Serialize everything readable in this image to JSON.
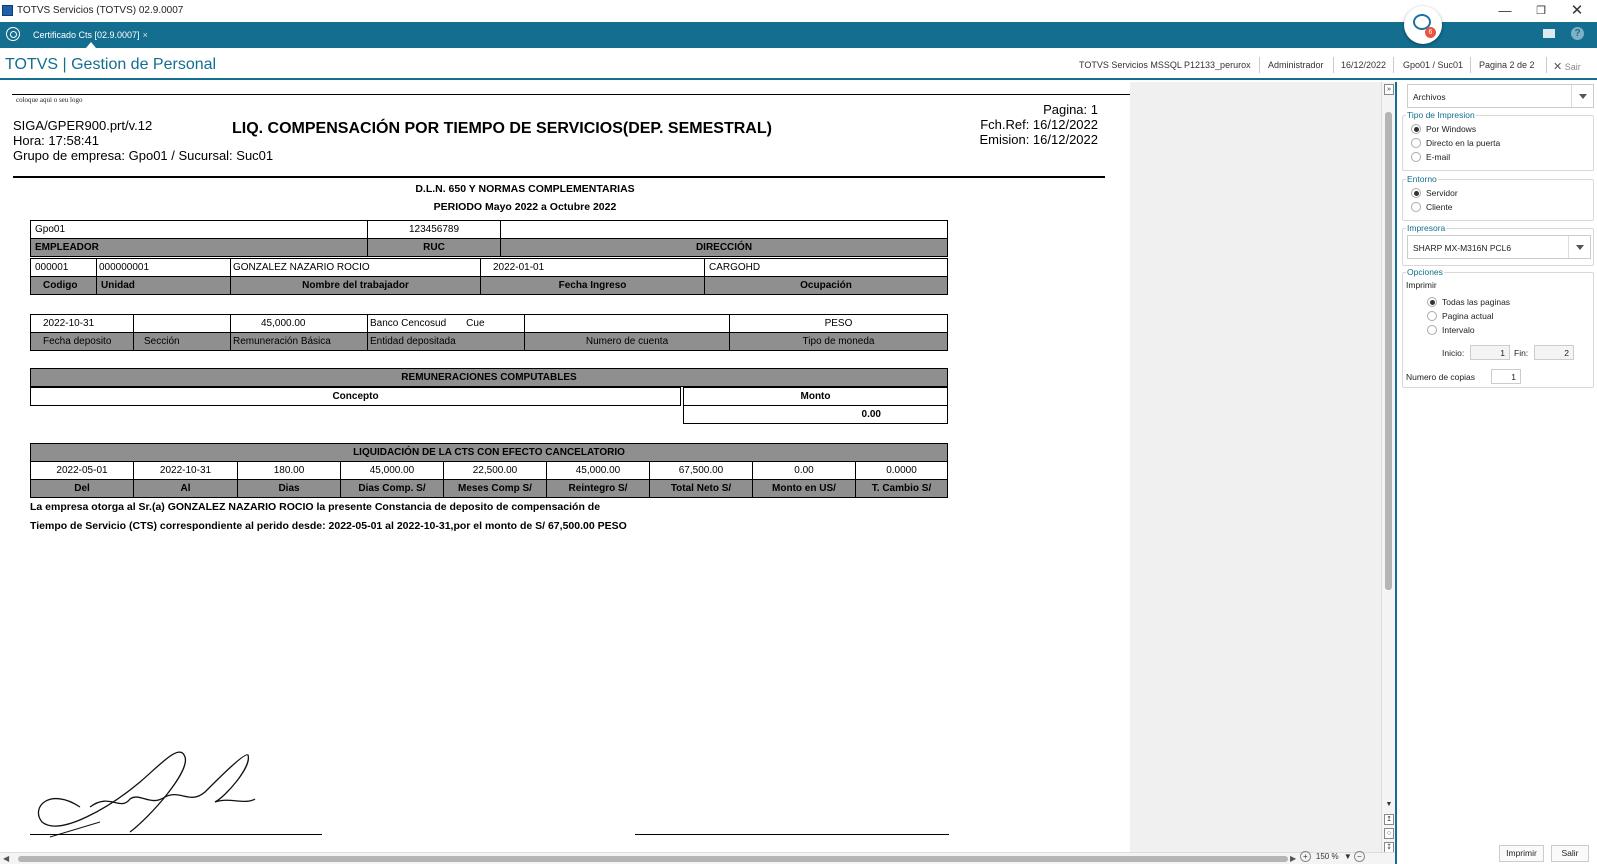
{
  "window": {
    "title": "TOTVS Servicios (TOTVS) 02.9.0007"
  },
  "tabs": [
    {
      "label": "Certificado Cts [02.9.0007]",
      "close": "×"
    }
  ],
  "chat_badge": "6",
  "header": {
    "brand": "TOTVS | Gestion de Personal",
    "env": "TOTVS Servicios MSSQL P12133_perurox",
    "user": "Administrador",
    "date": "16/12/2022",
    "branch": "Gpo01 / Suc01",
    "page": "Pagina 2 de 2",
    "exit": "Sair"
  },
  "report": {
    "logo": "coloque aqui o seu logo",
    "program": "SIGA/GPER900.prt/v.12",
    "time": "Hora: 17:58:41",
    "group": "Grupo de empresa: Gpo01 / Sucursal: Suc01",
    "title": "LIQ. COMPENSACIÓN POR TIEMPO DE SERVICIOS(DEP. SEMESTRAL)",
    "pagina": "Pagina:   1",
    "fchref": "Fch.Ref: 16/12/2022",
    "emision": "Emision: 16/12/2022",
    "decree": "D.L.N. 650 Y NORMAS COMPLEMENTARIAS",
    "period": "PERIODO  Mayo 2022 a Octubre 2022",
    "employer": {
      "name": "Gpo01",
      "ruc": "123456789",
      "address": ""
    },
    "employer_headers": {
      "employer": "EMPLEADOR",
      "ruc": "RUC",
      "address": "DIRECCIÓN"
    },
    "worker": {
      "code": "000001",
      "unit": "000000001",
      "name": "GONZALEZ NAZARIO ROCIO",
      "hire_date": "2022-01-01",
      "occupation": "CARGOHD"
    },
    "worker_headers": {
      "code": "Codigo",
      "unit": "Unidad",
      "name": "Nombre del trabajador",
      "hire_date": "Fecha Ingreso",
      "occupation": "Ocupación"
    },
    "deposit": {
      "date": "2022-10-31",
      "section": "",
      "salary": "45,000.00",
      "entity": "Banco Cencosud",
      "entity2": "Cue",
      "account": "",
      "currency": "PESO"
    },
    "deposit_headers": {
      "date": "Fecha deposito",
      "section": "Sección",
      "salary": "Remuneración Básica",
      "entity": "Entidad depositada",
      "account": "Numero de cuenta",
      "currency": "Tipo de moneda"
    },
    "remuneraciones": {
      "title": "REMUNERACIONES COMPUTABLES",
      "concept_header": "Concepto",
      "amount_header": "Monto",
      "total": "0.00"
    },
    "liquidacion": {
      "title": "LIQUIDACIÓN DE LA CTS CON EFECTO CANCELATORIO",
      "values": [
        "2022-05-01",
        "2022-10-31",
        "180.00",
        "45,000.00",
        "22,500.00",
        "45,000.00",
        "67,500.00",
        "0.00",
        "0.0000"
      ],
      "headers": [
        "Del",
        "Al",
        "Dias",
        "Dias Comp. S/",
        "Meses Comp S/",
        "Reintegro S/",
        "Total Neto S/",
        "Monto en  US/",
        "T. Cambio S/"
      ]
    },
    "statement_line1": "La empresa otorga al Sr.(a) GONZALEZ NAZARIO ROCIO la presente Constancia de deposito de compensación de",
    "statement_line2": "Tiempo de Servicio (CTS) correspondiente al perido desde: 2022-05-01 al 2022-10-31,por el monto de S/  67,500.00 PESO"
  },
  "zoom": "150 %",
  "panel": {
    "archivos": "Archivos",
    "tipo_impresion": {
      "legend": "Tipo de Impresion",
      "options": [
        "Por Windows",
        "Directo en la puerta",
        "E-mail"
      ],
      "selected": 0
    },
    "entorno": {
      "legend": "Entorno",
      "options": [
        "Servidor",
        "Cliente"
      ],
      "selected": 0
    },
    "impresora": {
      "legend": "Impresora",
      "value": "SHARP MX-M316N PCL6"
    },
    "opciones": {
      "legend": "Opciones",
      "imprimir": "Imprimir",
      "options": [
        "Todas las paginas",
        "Pagina actual",
        "Intervalo"
      ],
      "selected": 0,
      "inicio_label": "Inicio:",
      "inicio": "1",
      "fin_label": "Fin:",
      "fin": "2",
      "copias_label": "Numero de copias",
      "copias": "1"
    },
    "buttons": {
      "print": "Imprimir",
      "exit": "Salir"
    }
  }
}
